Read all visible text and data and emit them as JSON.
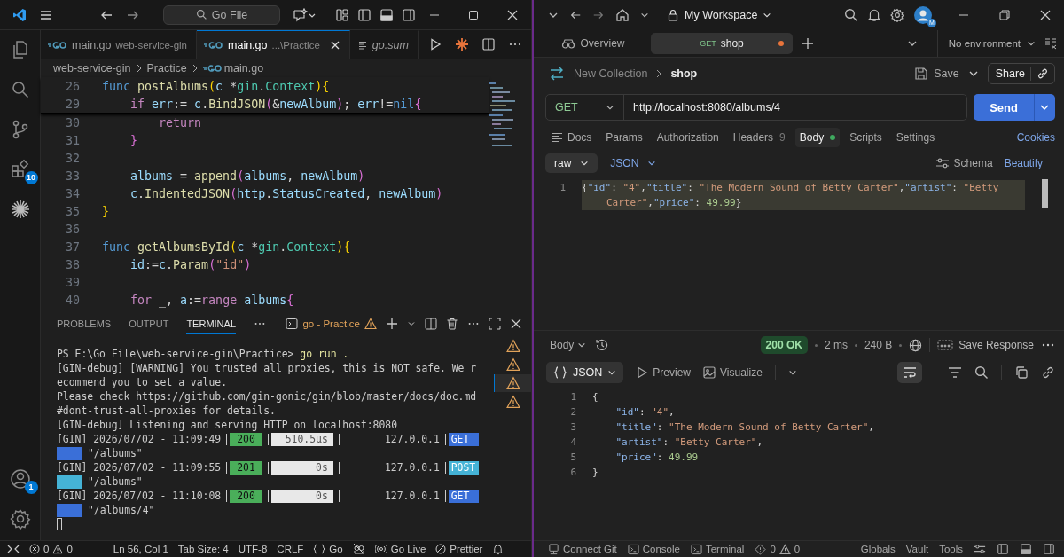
{
  "vscode": {
    "search": "Go File",
    "activity": {
      "extensions_badge": "10",
      "accounts_badge": "1"
    },
    "tabs": [
      {
        "label": "main.go",
        "detail": "web-service-gin",
        "selected": false,
        "preview": false,
        "kind": "go"
      },
      {
        "label": "main.go",
        "detail": "...\\Practice",
        "selected": true,
        "preview": false,
        "kind": "go"
      },
      {
        "label": "go.sum",
        "selected": false,
        "preview": true,
        "kind": "sum"
      }
    ],
    "breadcrumb": [
      {
        "label": "web-service-gin",
        "kind": "folder"
      },
      {
        "label": "Practice",
        "kind": "folder"
      },
      {
        "label": "main.go",
        "kind": "go"
      }
    ],
    "sticky_lines": [
      {
        "number": "26",
        "tokens": [
          {
            "kind": "kw",
            "text": "func "
          },
          {
            "kind": "fn",
            "text": "postAlbums"
          },
          {
            "kind": "b1",
            "text": "("
          },
          {
            "kind": "var",
            "text": "c"
          },
          {
            "kind": "plain",
            "text": " *"
          },
          {
            "kind": "type",
            "text": "gin"
          },
          {
            "kind": "plain",
            "text": "."
          },
          {
            "kind": "type",
            "text": "Context"
          },
          {
            "kind": "b1",
            "text": "){"
          }
        ]
      },
      {
        "number": "29",
        "tokens": [
          {
            "kind": "ctrl",
            "text": "    if"
          },
          {
            "kind": "var",
            "text": " err"
          },
          {
            "kind": "plain",
            "text": ":= "
          },
          {
            "kind": "var",
            "text": "c"
          },
          {
            "kind": "plain",
            "text": "."
          },
          {
            "kind": "fn",
            "text": "BindJSON"
          },
          {
            "kind": "b2",
            "text": "("
          },
          {
            "kind": "plain",
            "text": "&"
          },
          {
            "kind": "var",
            "text": "newAlbum"
          },
          {
            "kind": "b2",
            "text": ")"
          },
          {
            "kind": "plain",
            "text": "; "
          },
          {
            "kind": "var",
            "text": "err"
          },
          {
            "kind": "plain",
            "text": "!="
          },
          {
            "kind": "kw",
            "text": "nil"
          },
          {
            "kind": "b2",
            "text": "{"
          }
        ]
      }
    ],
    "code_lines": [
      {
        "number": "30",
        "tokens": [
          {
            "kind": "ctrl",
            "text": "        return"
          }
        ]
      },
      {
        "number": "31",
        "tokens": [
          {
            "kind": "b2",
            "text": "    }"
          }
        ]
      },
      {
        "number": "32"
      },
      {
        "number": "33",
        "tokens": [
          {
            "kind": "var",
            "text": "    albums"
          },
          {
            "kind": "plain",
            "text": " = "
          },
          {
            "kind": "fn",
            "text": "append"
          },
          {
            "kind": "b2",
            "text": "("
          },
          {
            "kind": "var",
            "text": "albums"
          },
          {
            "kind": "plain",
            "text": ", "
          },
          {
            "kind": "var",
            "text": "newAlbum"
          },
          {
            "kind": "b2",
            "text": ")"
          }
        ]
      },
      {
        "number": "34",
        "tokens": [
          {
            "kind": "var",
            "text": "    c"
          },
          {
            "kind": "plain",
            "text": "."
          },
          {
            "kind": "fn",
            "text": "IndentedJSON"
          },
          {
            "kind": "b2",
            "text": "("
          },
          {
            "kind": "var",
            "text": "http"
          },
          {
            "kind": "plain",
            "text": "."
          },
          {
            "kind": "var",
            "text": "StatusCreated"
          },
          {
            "kind": "plain",
            "text": ", "
          },
          {
            "kind": "var",
            "text": "newAlbum"
          },
          {
            "kind": "b2",
            "text": ")"
          }
        ]
      },
      {
        "number": "35",
        "tokens": [
          {
            "kind": "b1",
            "text": "}"
          }
        ]
      },
      {
        "number": "36"
      },
      {
        "number": "37",
        "tokens": [
          {
            "kind": "kw",
            "text": "func "
          },
          {
            "kind": "fn",
            "text": "getAlbumsById"
          },
          {
            "kind": "b1",
            "text": "("
          },
          {
            "kind": "var",
            "text": "c"
          },
          {
            "kind": "plain",
            "text": " *"
          },
          {
            "kind": "type",
            "text": "gin"
          },
          {
            "kind": "plain",
            "text": "."
          },
          {
            "kind": "type",
            "text": "Context"
          },
          {
            "kind": "b1",
            "text": "){"
          }
        ]
      },
      {
        "number": "38",
        "tokens": [
          {
            "kind": "var",
            "text": "    id"
          },
          {
            "kind": "plain",
            "text": ":="
          },
          {
            "kind": "var",
            "text": "c"
          },
          {
            "kind": "plain",
            "text": "."
          },
          {
            "kind": "fn",
            "text": "Param"
          },
          {
            "kind": "b2",
            "text": "("
          },
          {
            "kind": "str",
            "text": "\"id\""
          },
          {
            "kind": "b2",
            "text": ")"
          }
        ]
      },
      {
        "number": "39"
      },
      {
        "number": "40",
        "tokens": [
          {
            "kind": "ctrl",
            "text": "    for"
          },
          {
            "kind": "plain",
            "text": " _, "
          },
          {
            "kind": "var",
            "text": "a"
          },
          {
            "kind": "plain",
            "text": ":="
          },
          {
            "kind": "ctrl",
            "text": "range "
          },
          {
            "kind": "var",
            "text": "albums"
          },
          {
            "kind": "b2",
            "text": "{"
          }
        ]
      }
    ],
    "panel_tabs": [
      {
        "label": "PROBLEMS",
        "selected": false
      },
      {
        "label": "OUTPUT",
        "selected": false
      },
      {
        "label": "TERMINAL",
        "selected": true
      }
    ],
    "terminal_name": "go - Practice",
    "terminal_list": [
      {
        "selected": false
      },
      {
        "selected": false
      },
      {
        "selected": true
      },
      {
        "selected": false
      }
    ],
    "terminal_lines": [
      {
        "kind": "prompt",
        "text": "PS E:\\Go File\\web-service-gin\\Practice>",
        "command": "go run ."
      },
      {
        "kind": "text",
        "text": "[GIN-debug] [WARNING] You trusted all proxies, this is NOT safe. We r"
      },
      {
        "kind": "text",
        "text": "ecommend you to set a value."
      },
      {
        "kind": "text",
        "text": "Please check https://github.com/gin-gonic/gin/blob/master/docs/doc.md"
      },
      {
        "kind": "text",
        "text": "#dont-trust-all-proxies for details."
      },
      {
        "kind": "text",
        "text": "[GIN-debug] Listening and serving HTTP on localhost:8080"
      },
      {
        "kind": "request",
        "prefix": "[GIN] 2026/07/02 - 11:09:49",
        "status": "200",
        "latency": "510.5µs",
        "ip": "127.0.0.1",
        "method": "GET",
        "path": "\"/albums\"",
        "color": "#3a6fd8"
      },
      {
        "kind": "request",
        "prefix": "[GIN] 2026/07/02 - 11:09:55",
        "status": "201",
        "latency": "0s",
        "ip": "127.0.0.1",
        "method": "POST",
        "path": "\"/albums\"",
        "color": "#45b3d6"
      },
      {
        "kind": "request",
        "prefix": "[GIN] 2026/07/02 - 11:10:08",
        "status": "200",
        "latency": "0s",
        "ip": "127.0.0.1",
        "method": "GET",
        "path": "\"/albums/4\"",
        "color": "#3a6fd8"
      }
    ],
    "status_bar": {
      "errors": "0",
      "warnings": "0",
      "position": "Ln 56, Col 1",
      "tab_size": "Tab Size: 4",
      "encoding": "UTF-8",
      "eol": "CRLF",
      "language": "Go",
      "live": "Go Live",
      "formatter": "Prettier"
    }
  },
  "postman": {
    "workspace": "My Workspace",
    "avatar_badge": "M",
    "tabs": [
      {
        "kind": "overview",
        "label": "Overview",
        "selected": false
      },
      {
        "kind": "request",
        "method": "GET",
        "label": "shop",
        "selected": true,
        "unsaved": true
      }
    ],
    "environment": "No environment",
    "breadcrumb": {
      "collection": "New Collection",
      "request": "shop"
    },
    "save": "Save",
    "share": "Share",
    "request": {
      "method": "GET",
      "url": "http://localhost:8080/albums/4",
      "send": "Send"
    },
    "request_tabs": [
      {
        "label": "Docs",
        "selected": false,
        "indicator": false
      },
      {
        "label": "Params",
        "selected": false,
        "indicator": false
      },
      {
        "label": "Authorization",
        "selected": false,
        "indicator": false
      },
      {
        "label": "Headers",
        "count": "9",
        "selected": false,
        "indicator": false
      },
      {
        "label": "Body",
        "selected": true,
        "indicator": true
      },
      {
        "label": "Scripts",
        "selected": false,
        "indicator": false
      },
      {
        "label": "Settings",
        "selected": false,
        "indicator": false
      }
    ],
    "cookies": "Cookies",
    "body_mode": "raw",
    "body_format": "JSON",
    "schema": "Schema",
    "beautify": "Beautify",
    "body_editor": {
      "number": "1",
      "tokens": [
        {
          "kind": "jpunct",
          "text": "{"
        },
        {
          "kind": "jkey",
          "text": "\"id\""
        },
        {
          "kind": "jpunct",
          "text": ": "
        },
        {
          "kind": "jstr",
          "text": "\"4\""
        },
        {
          "kind": "jpunct",
          "text": ","
        },
        {
          "kind": "jkey",
          "text": "\"title\""
        },
        {
          "kind": "jpunct",
          "text": ": "
        },
        {
          "kind": "jstr",
          "text": "\"The Modern Sound of Betty Carter\""
        },
        {
          "kind": "jpunct",
          "text": ","
        },
        {
          "kind": "jkey",
          "text": "\"artist\""
        },
        {
          "kind": "jpunct",
          "text": ": "
        },
        {
          "kind": "jstr",
          "text": "\"Betty Carter\""
        },
        {
          "kind": "jpunct",
          "text": ","
        },
        {
          "kind": "jkey",
          "text": "\"price\""
        },
        {
          "kind": "jpunct",
          "text": ": "
        },
        {
          "kind": "jnum",
          "text": "49.99"
        },
        {
          "kind": "jpunct",
          "text": "}"
        }
      ]
    },
    "response": {
      "view": "Body",
      "status": "200 OK",
      "time": "2 ms",
      "size": "240 B",
      "save_response": "Save Response",
      "format": "JSON",
      "preview": "Preview",
      "visualize": "Visualize",
      "lines": [
        {
          "number": "1",
          "tokens": [
            {
              "kind": "jpunct",
              "text": "{"
            }
          ]
        },
        {
          "number": "2",
          "tokens": [
            {
              "kind": "jkey",
              "text": "    \"id\""
            },
            {
              "kind": "jpunct",
              "text": ": "
            },
            {
              "kind": "jstr",
              "text": "\"4\""
            },
            {
              "kind": "jpunct",
              "text": ","
            }
          ]
        },
        {
          "number": "3",
          "tokens": [
            {
              "kind": "jkey",
              "text": "    \"title\""
            },
            {
              "kind": "jpunct",
              "text": ": "
            },
            {
              "kind": "jstr",
              "text": "\"The Modern Sound of Betty Carter\""
            },
            {
              "kind": "jpunct",
              "text": ","
            }
          ]
        },
        {
          "number": "4",
          "tokens": [
            {
              "kind": "jkey",
              "text": "    \"artist\""
            },
            {
              "kind": "jpunct",
              "text": ": "
            },
            {
              "kind": "jstr",
              "text": "\"Betty Carter\""
            },
            {
              "kind": "jpunct",
              "text": ","
            }
          ]
        },
        {
          "number": "5",
          "tokens": [
            {
              "kind": "jkey",
              "text": "    \"price\""
            },
            {
              "kind": "jpunct",
              "text": ": "
            },
            {
              "kind": "jnum",
              "text": "49.99"
            }
          ]
        },
        {
          "number": "6",
          "tokens": [
            {
              "kind": "jpunct",
              "text": "}"
            }
          ]
        }
      ]
    },
    "status_bar": {
      "left": [
        "Connect Git",
        "Console",
        "Terminal"
      ],
      "errors": "0",
      "warnings": "0",
      "right": [
        "Globals",
        "Vault",
        "Tools"
      ]
    }
  }
}
